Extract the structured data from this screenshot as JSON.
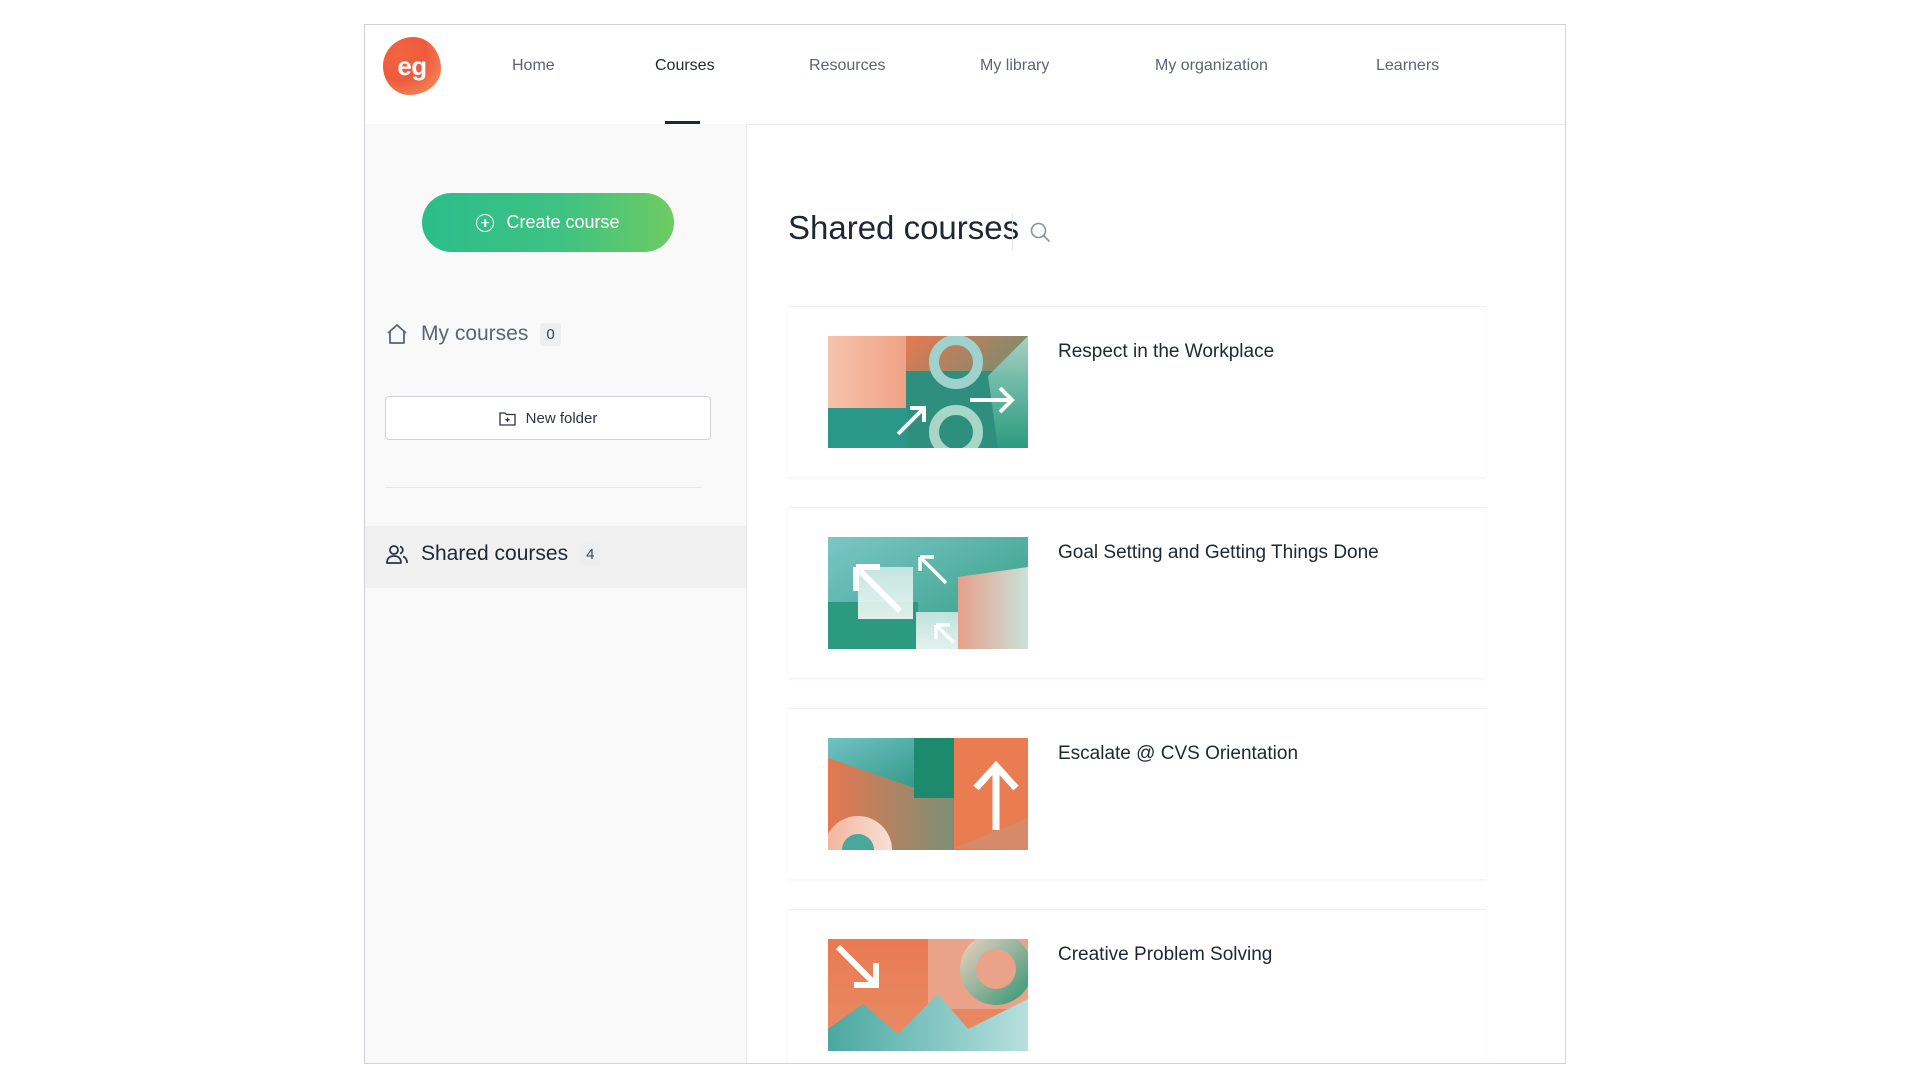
{
  "brand": {
    "logo_text": "eg",
    "accent": "#ee5a3e",
    "green": "#2bbd8b"
  },
  "nav": {
    "items": [
      {
        "label": "Home"
      },
      {
        "label": "Courses",
        "active": true
      },
      {
        "label": "Resources"
      },
      {
        "label": "My library"
      },
      {
        "label": "My organization"
      },
      {
        "label": "Learners"
      }
    ]
  },
  "sidebar": {
    "create_label": "Create course",
    "my_courses": {
      "label": "My courses",
      "count": "0",
      "icon": "home-icon"
    },
    "new_folder_label": "New folder",
    "shared_courses": {
      "label": "Shared courses",
      "count": "4",
      "icon": "users-icon"
    }
  },
  "main": {
    "title": "Shared courses",
    "courses": [
      {
        "title": "Respect in the Workplace"
      },
      {
        "title": "Goal Setting and Getting Things Done"
      },
      {
        "title": "Escalate @ CVS Orientation"
      },
      {
        "title": "Creative Problem Solving"
      }
    ]
  }
}
